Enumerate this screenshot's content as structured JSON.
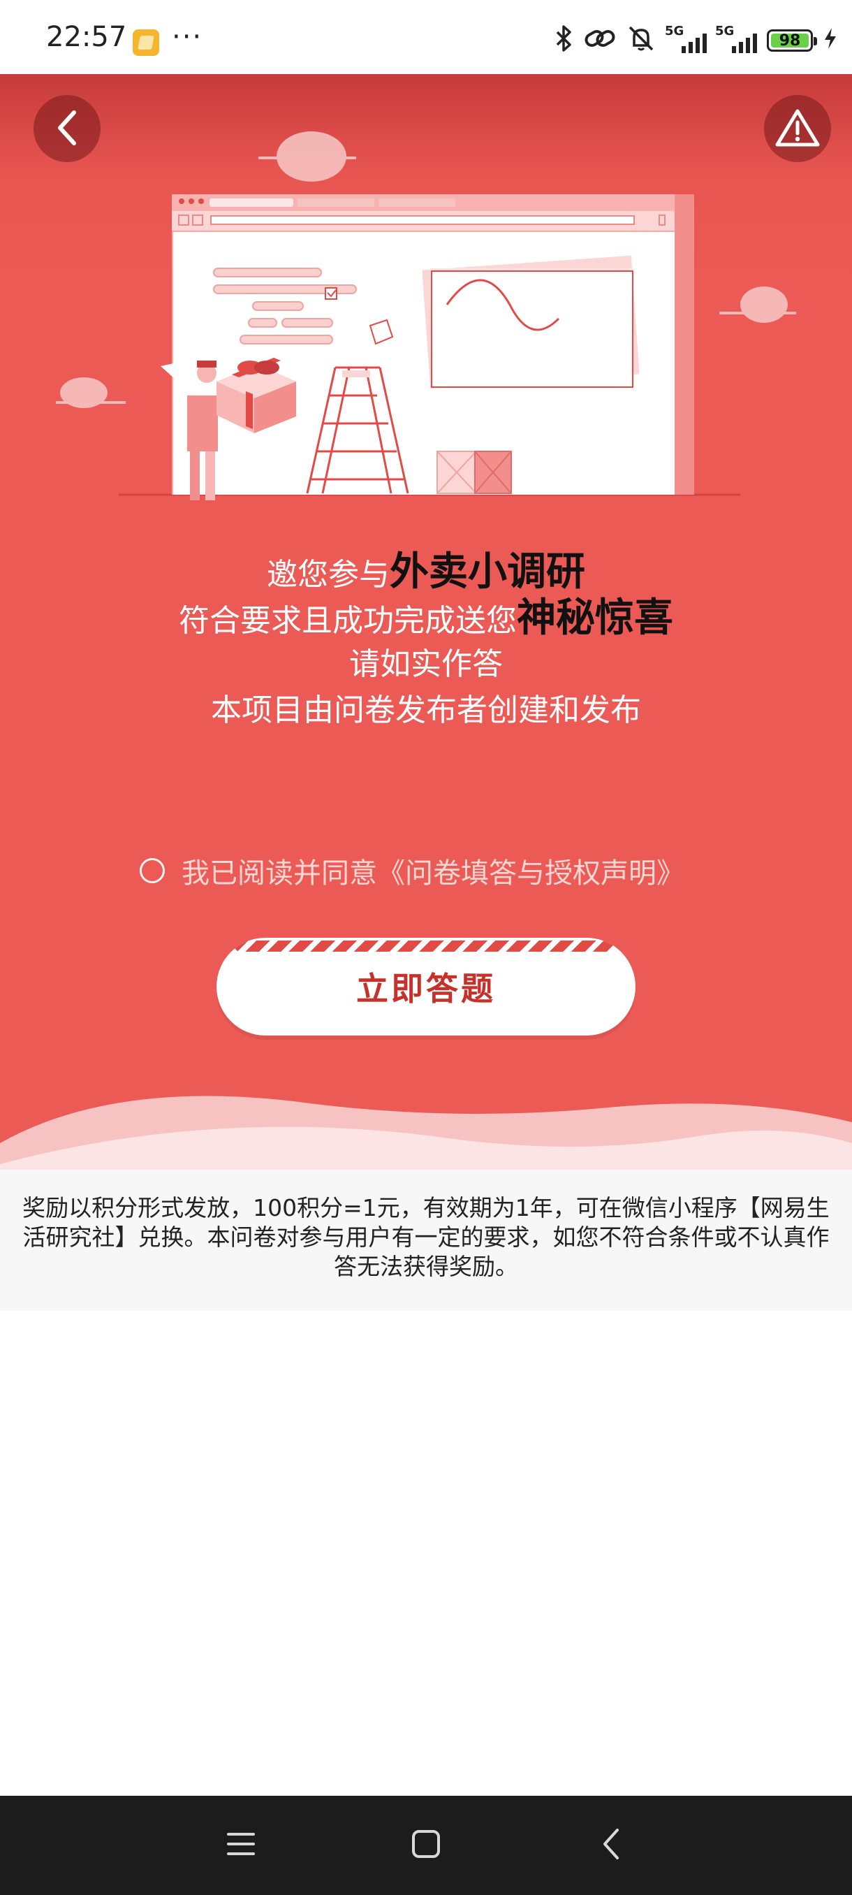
{
  "status_bar": {
    "time": "22:57",
    "more_dots": "···",
    "battery": "98",
    "network_1": "5G",
    "network_2": "5G",
    "icons": [
      "app-notification-icon",
      "bluetooth-icon",
      "link-icon",
      "mute-icon",
      "signal-icon",
      "battery-icon",
      "charging-icon"
    ]
  },
  "header": {
    "back_icon": "chevron-left-icon",
    "report_icon": "warning-icon"
  },
  "intro": {
    "line1_prefix": "邀您参与",
    "line1_highlight": "外卖小调研",
    "line2_prefix": "符合要求且成功完成送您",
    "line2_highlight": "神秘惊喜",
    "line3": "请如实作答",
    "line4": "本项目由问卷发布者创建和发布"
  },
  "agreement": {
    "label": "我已阅读并同意《问卷填答与授权声明》",
    "checked": false
  },
  "start_button": {
    "label": "立即答题"
  },
  "footer_note": {
    "text": "奖励以积分形式发放，100积分=1元，有效期为1年，可在微信小程序【网易生活研究社】兑换。本问卷对参与用户有一定的要求，如您不符合条件或不认真作答无法获得奖励。"
  },
  "nav_bar": {
    "items": [
      "menu-icon",
      "home-icon",
      "back-icon"
    ]
  },
  "colors": {
    "primary_red": "#ec5a55",
    "button_text": "#c8302a",
    "highlight_text": "#111111"
  }
}
